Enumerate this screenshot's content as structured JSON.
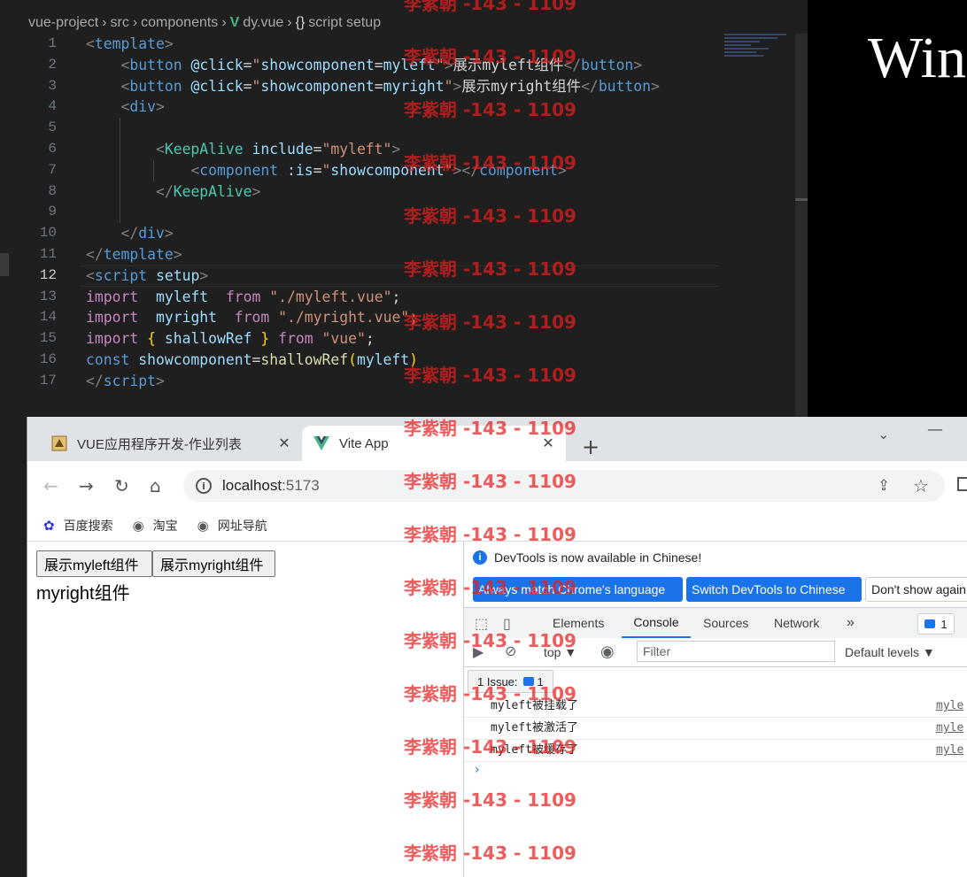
{
  "editor": {
    "breadcrumb": [
      "vue-project",
      "src",
      "components",
      "dy.vue",
      "script setup"
    ],
    "lines": [
      {
        "n": "1",
        "tokens": [
          {
            "c": "tg",
            "t": "<"
          },
          {
            "c": "tn",
            "t": "template"
          },
          {
            "c": "tg",
            "t": ">"
          }
        ]
      },
      {
        "n": "2",
        "tokens": [
          {
            "c": "df",
            "t": "    "
          },
          {
            "c": "tg",
            "t": "<"
          },
          {
            "c": "tn",
            "t": "button"
          },
          {
            "c": "df",
            "t": " "
          },
          {
            "c": "at",
            "t": "@click"
          },
          {
            "c": "df",
            "t": "="
          },
          {
            "c": "st",
            "t": "\""
          },
          {
            "c": "at",
            "t": "showcomponent"
          },
          {
            "c": "df",
            "t": "="
          },
          {
            "c": "at",
            "t": "myleft"
          },
          {
            "c": "st",
            "t": "\""
          },
          {
            "c": "tg",
            "t": ">"
          },
          {
            "c": "df",
            "t": "展示myleft组件"
          },
          {
            "c": "tg",
            "t": "</"
          },
          {
            "c": "tn",
            "t": "button"
          },
          {
            "c": "tg",
            "t": ">"
          }
        ]
      },
      {
        "n": "3",
        "tokens": [
          {
            "c": "df",
            "t": "    "
          },
          {
            "c": "tg",
            "t": "<"
          },
          {
            "c": "tn",
            "t": "button"
          },
          {
            "c": "df",
            "t": " "
          },
          {
            "c": "at",
            "t": "@click"
          },
          {
            "c": "df",
            "t": "="
          },
          {
            "c": "st",
            "t": "\""
          },
          {
            "c": "at",
            "t": "showcomponent"
          },
          {
            "c": "df",
            "t": "="
          },
          {
            "c": "at",
            "t": "myright"
          },
          {
            "c": "st",
            "t": "\""
          },
          {
            "c": "tg",
            "t": ">"
          },
          {
            "c": "df",
            "t": "展示myright组件"
          },
          {
            "c": "tg",
            "t": "</"
          },
          {
            "c": "tn",
            "t": "button"
          },
          {
            "c": "tg",
            "t": ">"
          }
        ]
      },
      {
        "n": "4",
        "tokens": [
          {
            "c": "df",
            "t": "    "
          },
          {
            "c": "tg",
            "t": "<"
          },
          {
            "c": "tn",
            "t": "div"
          },
          {
            "c": "tg",
            "t": ">"
          }
        ]
      },
      {
        "n": "5",
        "tokens": []
      },
      {
        "n": "6",
        "tokens": [
          {
            "c": "df",
            "t": "        "
          },
          {
            "c": "tg",
            "t": "<"
          },
          {
            "c": "cp",
            "t": "KeepAlive"
          },
          {
            "c": "df",
            "t": " "
          },
          {
            "c": "at",
            "t": "include"
          },
          {
            "c": "df",
            "t": "="
          },
          {
            "c": "st",
            "t": "\"myleft\""
          },
          {
            "c": "tg",
            "t": ">"
          }
        ]
      },
      {
        "n": "7",
        "tokens": [
          {
            "c": "df",
            "t": "            "
          },
          {
            "c": "tg",
            "t": "<"
          },
          {
            "c": "tn",
            "t": "component"
          },
          {
            "c": "df",
            "t": " "
          },
          {
            "c": "at",
            "t": ":is"
          },
          {
            "c": "df",
            "t": "="
          },
          {
            "c": "st",
            "t": "\""
          },
          {
            "c": "at",
            "t": "showcomponent"
          },
          {
            "c": "st",
            "t": "\""
          },
          {
            "c": "tg",
            "t": "></"
          },
          {
            "c": "tn",
            "t": "component"
          },
          {
            "c": "tg",
            "t": ">"
          }
        ]
      },
      {
        "n": "8",
        "tokens": [
          {
            "c": "df",
            "t": "        "
          },
          {
            "c": "tg",
            "t": "</"
          },
          {
            "c": "cp",
            "t": "KeepAlive"
          },
          {
            "c": "tg",
            "t": ">"
          }
        ]
      },
      {
        "n": "9",
        "tokens": []
      },
      {
        "n": "10",
        "tokens": [
          {
            "c": "df",
            "t": "    "
          },
          {
            "c": "tg",
            "t": "</"
          },
          {
            "c": "tn",
            "t": "div"
          },
          {
            "c": "tg",
            "t": ">"
          }
        ]
      },
      {
        "n": "11",
        "tokens": [
          {
            "c": "tg",
            "t": "</"
          },
          {
            "c": "tn",
            "t": "template"
          },
          {
            "c": "tg",
            "t": ">"
          }
        ]
      },
      {
        "n": "12",
        "active": true,
        "tokens": [
          {
            "c": "tg",
            "t": "<"
          },
          {
            "c": "tn",
            "t": "script"
          },
          {
            "c": "df",
            "t": " "
          },
          {
            "c": "at",
            "t": "setup"
          },
          {
            "c": "tg",
            "t": ">"
          }
        ]
      },
      {
        "n": "13",
        "tokens": [
          {
            "c": "kw",
            "t": "import"
          },
          {
            "c": "df",
            "t": "  "
          },
          {
            "c": "at",
            "t": "myleft"
          },
          {
            "c": "df",
            "t": "  "
          },
          {
            "c": "kw",
            "t": "from"
          },
          {
            "c": "df",
            "t": " "
          },
          {
            "c": "st",
            "t": "\"./myleft.vue\""
          },
          {
            "c": "df",
            "t": ";"
          }
        ]
      },
      {
        "n": "14",
        "tokens": [
          {
            "c": "kw",
            "t": "import"
          },
          {
            "c": "df",
            "t": "  "
          },
          {
            "c": "at",
            "t": "myright"
          },
          {
            "c": "df",
            "t": "  "
          },
          {
            "c": "kw",
            "t": "from"
          },
          {
            "c": "df",
            "t": " "
          },
          {
            "c": "st",
            "t": "\"./myright.vue\""
          },
          {
            "c": "df",
            "t": ";"
          }
        ]
      },
      {
        "n": "15",
        "tokens": [
          {
            "c": "kw",
            "t": "import"
          },
          {
            "c": "df",
            "t": " "
          },
          {
            "c": "br",
            "t": "{"
          },
          {
            "c": "df",
            "t": " "
          },
          {
            "c": "at",
            "t": "shallowRef"
          },
          {
            "c": "df",
            "t": " "
          },
          {
            "c": "br",
            "t": "}"
          },
          {
            "c": "df",
            "t": " "
          },
          {
            "c": "kw",
            "t": "from"
          },
          {
            "c": "df",
            "t": " "
          },
          {
            "c": "st",
            "t": "\"vue\""
          },
          {
            "c": "df",
            "t": ";"
          }
        ]
      },
      {
        "n": "16",
        "tokens": [
          {
            "c": "kw2",
            "t": "const"
          },
          {
            "c": "df",
            "t": " "
          },
          {
            "c": "at",
            "t": "showcomponent"
          },
          {
            "c": "df",
            "t": "="
          },
          {
            "c": "fn",
            "t": "shallowRef"
          },
          {
            "c": "br",
            "t": "("
          },
          {
            "c": "at",
            "t": "myleft"
          },
          {
            "c": "br",
            "t": ")"
          }
        ]
      },
      {
        "n": "17",
        "tokens": [
          {
            "c": "tg",
            "t": "</"
          },
          {
            "c": "tn",
            "t": "script"
          },
          {
            "c": "tg",
            "t": ">"
          }
        ]
      }
    ]
  },
  "right_pane": {
    "text": "Win"
  },
  "browser": {
    "tabs": [
      {
        "title": "VUE应用程序开发-作业列表",
        "close": "✕"
      },
      {
        "title": "Vite App",
        "close": "✕"
      }
    ],
    "new_tab": "+",
    "url_host": "localhost",
    "url_port": ":5173",
    "bookmarks": [
      "百度搜索",
      "淘宝",
      "网址导航"
    ]
  },
  "page": {
    "btn_left": "展示myleft组件",
    "btn_right": "展示myright组件",
    "component_text": "myright组件"
  },
  "devtools": {
    "banner_msg": "DevTools is now available in Chinese!",
    "btn_match": "Always match Chrome's language",
    "btn_switch": "Switch DevTools to Chinese",
    "btn_dont": "Don't show again",
    "tabs": [
      "Elements",
      "Console",
      "Sources",
      "Network"
    ],
    "more": "»",
    "badge_count": "1",
    "context": "top ▼",
    "filter_placeholder": "Filter",
    "levels": "Default levels ▼",
    "issues_label": "1 Issue:",
    "issues_count": "1",
    "logs": [
      {
        "msg": "myleft被挂载了",
        "src": "myle"
      },
      {
        "msg": "myleft被激活了",
        "src": "myle"
      },
      {
        "msg": "myleft被缓存了",
        "src": "myle"
      }
    ],
    "prompt": "›"
  },
  "watermark": "李紫朝 -143 - 1109"
}
